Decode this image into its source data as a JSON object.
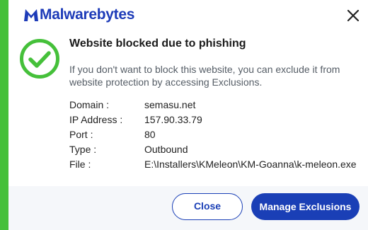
{
  "brand": {
    "name": "Malwarebytes",
    "color": "#1d3bb8"
  },
  "colors": {
    "accent": "#45c03a",
    "primary": "#1a3fb6"
  },
  "icons": {
    "logo": "malwarebytes-logo-icon",
    "close": "close-icon",
    "status": "check-circle-icon"
  },
  "alert": {
    "title": "Website blocked due to phishing",
    "description": "If you don't want to block this website, you can exclude it from website protection by accessing Exclusions."
  },
  "details": [
    {
      "label": "Domain :",
      "value": "semasu.net"
    },
    {
      "label": "IP Address :",
      "value": "157.90.33.79"
    },
    {
      "label": "Port :",
      "value": "80"
    },
    {
      "label": "Type :",
      "value": "Outbound"
    },
    {
      "label": "File :",
      "value": "E:\\Installers\\KMeleon\\KM-Goanna\\k-meleon.exe"
    }
  ],
  "buttons": {
    "close": "Close",
    "manage": "Manage Exclusions"
  }
}
